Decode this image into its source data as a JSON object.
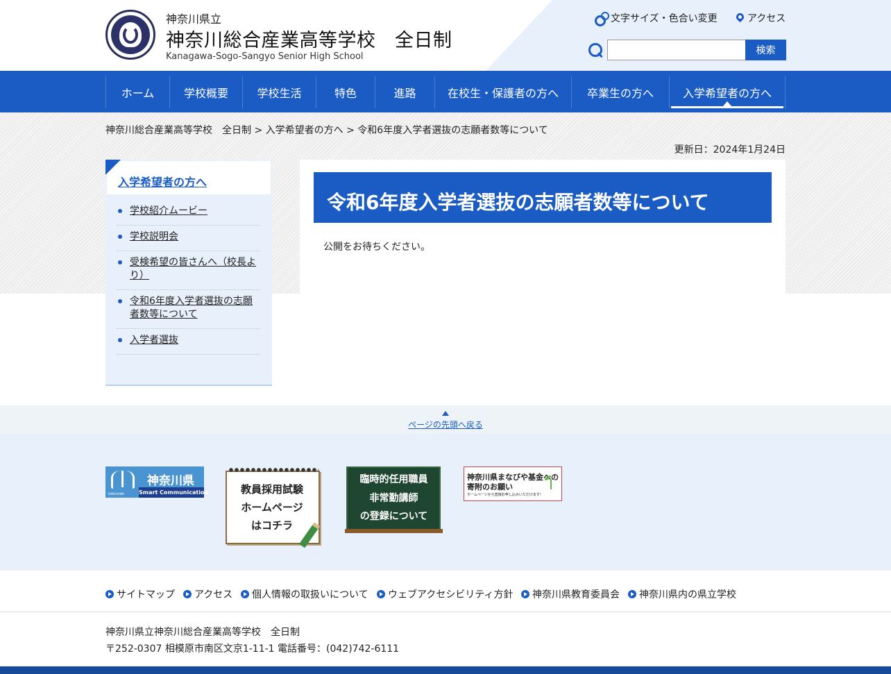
{
  "header": {
    "prefecture": "神奈川県立",
    "school_name": "神奈川総合産業高等学校　全日制",
    "school_name_en": "Kanagawa-Sogo-Sangyo Senior High School",
    "font_size_color_label": "文字サイズ・色合い変更",
    "access_label": "アクセス",
    "search_value": "",
    "search_button": "検索",
    "icons": {
      "settings": "gear-icon",
      "access": "map-pin-icon",
      "search": "search-icon"
    }
  },
  "nav": {
    "items": [
      {
        "label": "ホーム"
      },
      {
        "label": "学校概要"
      },
      {
        "label": "学校生活"
      },
      {
        "label": "特色"
      },
      {
        "label": "進路"
      },
      {
        "label": "在校生・保護者の方へ"
      },
      {
        "label": "卒業生の方へ"
      },
      {
        "label": "入学希望者の方へ"
      }
    ],
    "active": "入学希望者の方へ"
  },
  "breadcrumb": {
    "items": [
      "神奈川総合産業高等学校　全日制",
      "入学希望者の方へ",
      "令和6年度入学者選抜の志願者数等について"
    ],
    "separator": ">"
  },
  "updated": "更新日：2024年1月24日",
  "sidebar": {
    "title": "入学希望者の方へ",
    "items": [
      {
        "label": "学校紹介ムービー"
      },
      {
        "label": "学校説明会"
      },
      {
        "label": "受検希望の皆さんへ（校長より）"
      },
      {
        "label": "令和6年度入学者選抜の志願者数等について"
      },
      {
        "label": "入学者選抜"
      }
    ]
  },
  "main": {
    "title": "令和6年度入学者選抜の志願者数等について",
    "text": "公開をお待ちください。"
  },
  "pagetop": {
    "label": "ページの先頭へ戻る"
  },
  "banners": {
    "kanagawa": {
      "name": "神奈川県",
      "sub": "Smart Communication",
      "mini": "KANAGAWA"
    },
    "teacher": {
      "line1": "教員採用試験",
      "line2": "ホームページ",
      "line3": "はコチラ"
    },
    "temporary": {
      "line1": "臨時的任用職員",
      "line2": "非常勤講師",
      "line3": "の登録について"
    },
    "fund": {
      "line1": "神奈川県まなびや基金への",
      "line2": "寄附のお願い",
      "line3": "ホームページから直接お申し込みいただけます！"
    }
  },
  "footer": {
    "links": [
      {
        "label": "サイトマップ"
      },
      {
        "label": "アクセス"
      },
      {
        "label": "個人情報の取扱いについて"
      },
      {
        "label": "ウェブアクセシビリティ方針"
      },
      {
        "label": "神奈川県教育委員会"
      },
      {
        "label": "神奈川県内の県立学校"
      }
    ],
    "school_name": "神奈川県立神奈川総合産業高等学校　全日制",
    "address": "〒252-0307 相模原市南区文京1-11-1 電話番号：(042)742-6111"
  },
  "colors": {
    "primary": "#1b5cc4",
    "light_bg": "#e7f0fb",
    "footer_bar": "#174b99"
  }
}
